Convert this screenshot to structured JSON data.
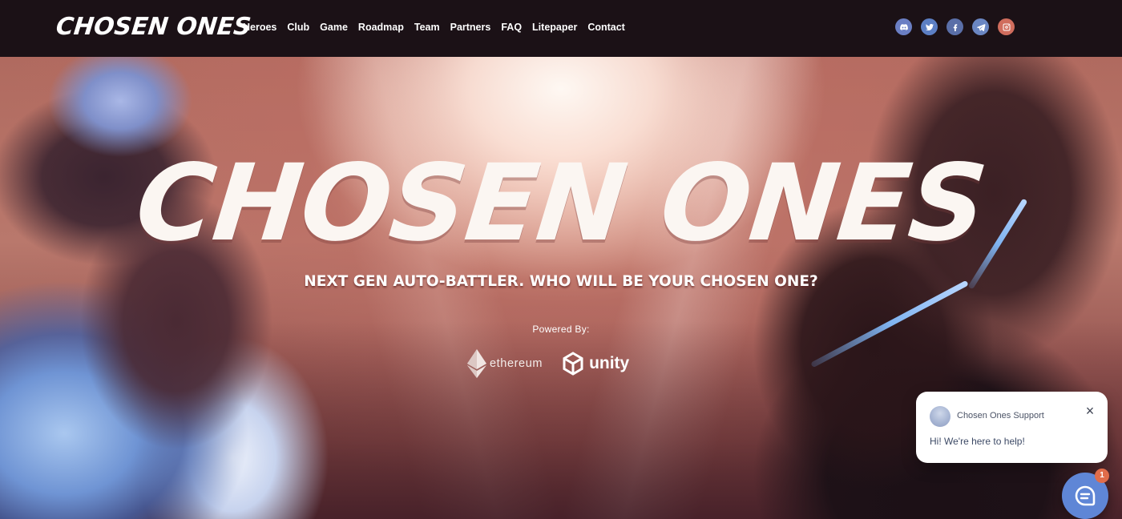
{
  "header": {
    "logo": "CHOSEN ONES",
    "nav": [
      "Heroes",
      "Club",
      "Game",
      "Roadmap",
      "Team",
      "Partners",
      "FAQ",
      "Litepaper",
      "Contact"
    ],
    "socials": [
      {
        "icon": "discord-icon",
        "color": "#6b7fc4"
      },
      {
        "icon": "twitter-icon",
        "color": "#5c7fc4"
      },
      {
        "icon": "facebook-icon",
        "color": "#5a6fa8"
      },
      {
        "icon": "telegram-icon",
        "color": "#6a86c2"
      },
      {
        "icon": "instagram-icon",
        "color": "#d06d5d"
      }
    ]
  },
  "hero": {
    "title": "CHOSEN ONES",
    "tagline": "NEXT GEN AUTO-BATTLER. WHO WILL BE YOUR CHOSEN ONE?",
    "powered_by": "Powered By:",
    "partners": {
      "ethereum": "ethereum",
      "unity": "unity"
    }
  },
  "support": {
    "name": "Chosen Ones Support",
    "message": "Hi! We're here to help!",
    "close": "×",
    "badge_count": "1"
  },
  "colors": {
    "header_bg": "#1b1116",
    "support_blue": "#5f86d6",
    "badge": "#e06c4a"
  }
}
